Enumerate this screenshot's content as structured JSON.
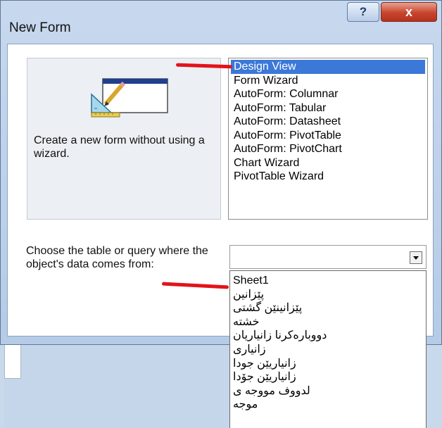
{
  "window": {
    "title": "New Form"
  },
  "titlebar": {
    "help_glyph": "?",
    "close_glyph": "x"
  },
  "preview": {
    "text": "Create a new form without using a wizard.",
    "icon": "form-design-icon"
  },
  "options": [
    "Design View",
    "Form Wizard",
    "AutoForm: Columnar",
    "AutoForm: Tabular",
    "AutoForm: Datasheet",
    "AutoForm: PivotTable",
    "AutoForm: PivotChart",
    "Chart Wizard",
    "PivotTable Wizard"
  ],
  "selected_option": "Design View",
  "source": {
    "label": "Choose the table or query where the object's data comes from:",
    "value": "",
    "dropdown_items": [
      "Sheet1",
      "پێزانین",
      "پێزانینێن گشتی",
      "خشته",
      "دووبارەکرنا زانیاریان",
      "زانیاری",
      "زانیاریێن جودا",
      "زانیاریێن جۆدا",
      "لدووف مووجه ی",
      "موجه"
    ]
  },
  "colors": {
    "selection": "#3b78d8",
    "close": "#c8442d",
    "annotation": "#e2141a"
  }
}
